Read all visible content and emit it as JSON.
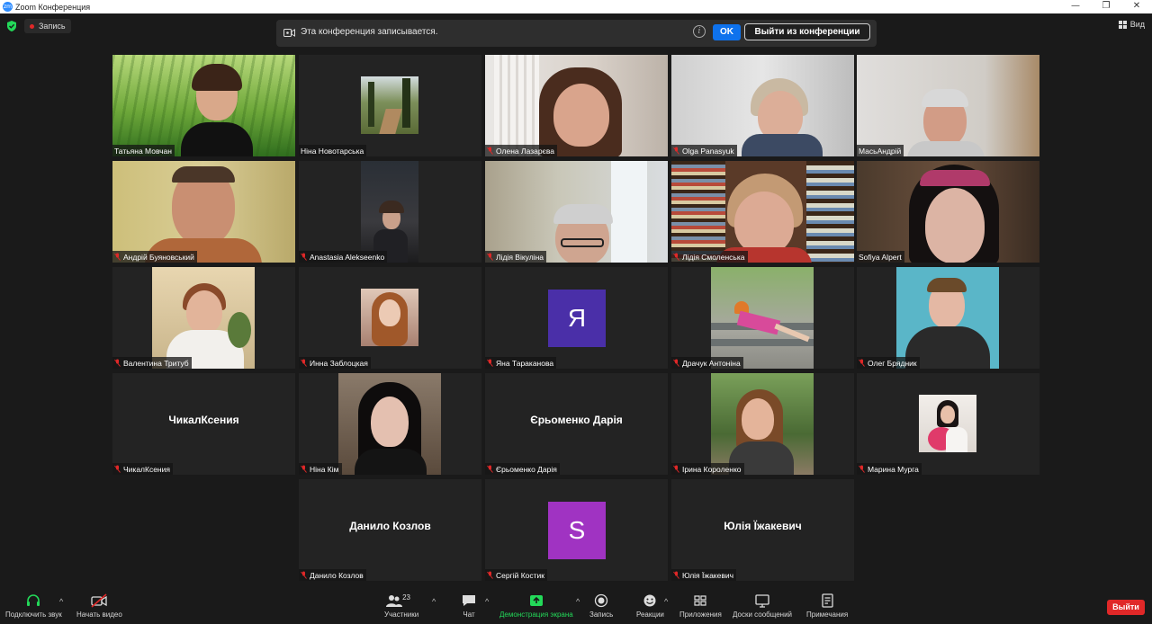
{
  "window": {
    "title": "Zoom Конференция",
    "controls": [
      "—",
      "❐",
      "✕"
    ]
  },
  "topbar": {
    "recording_label": "Запись",
    "view_label": "Вид"
  },
  "banner": {
    "message": "Эта конференция записывается.",
    "ok_label": "OK",
    "leave_label": "Выйти из конференции",
    "info_glyph": "i"
  },
  "colors": {
    "accent": "#0e72ed",
    "danger": "#e02828",
    "active_speaker": "#e8e84a",
    "avatar_ya": "#4a2fa8",
    "avatar_s": "#a033c2"
  },
  "participants": [
    {
      "name": "Татьяна Мовчан",
      "kind": "video",
      "muted": false
    },
    {
      "name": "Ніна Новотарська",
      "kind": "photo",
      "muted": false
    },
    {
      "name": "Олена Лазарєва",
      "kind": "video",
      "muted": true
    },
    {
      "name": "Olga Panasyuk",
      "kind": "video",
      "muted": true
    },
    {
      "name": "МасьАндрій",
      "kind": "video",
      "muted": false
    },
    {
      "name": "Андрій Буяновський",
      "kind": "video",
      "muted": true
    },
    {
      "name": "Anastasia Alekseenko",
      "kind": "video",
      "muted": true
    },
    {
      "name": "Лідія Вікуліна",
      "kind": "video",
      "muted": true
    },
    {
      "name": "Лідія Смоленська",
      "kind": "video",
      "muted": true
    },
    {
      "name": "Sofiya Alpert",
      "kind": "video",
      "muted": false,
      "active": true
    },
    {
      "name": "Валентина Тритуб",
      "kind": "photo",
      "muted": true
    },
    {
      "name": "Инна Заблоцкая",
      "kind": "photo",
      "muted": true
    },
    {
      "name": "Яна Тараканова",
      "kind": "avatar",
      "initial": "Я",
      "muted": true
    },
    {
      "name": "Драчук Антоніна",
      "kind": "photo",
      "muted": true
    },
    {
      "name": "Олег Брядник",
      "kind": "photo",
      "muted": true
    },
    {
      "name": "ЧикалКсения",
      "kind": "name",
      "muted": true
    },
    {
      "name": "Ніна Кім",
      "kind": "photo",
      "muted": true
    },
    {
      "name": "Єрьоменко Дарія",
      "kind": "name",
      "muted": true
    },
    {
      "name": "Ірина Короленко",
      "kind": "photo",
      "muted": true
    },
    {
      "name": "Марина Мурга",
      "kind": "photo",
      "muted": true
    },
    {
      "name": "Данило Козлов",
      "kind": "name",
      "muted": true
    },
    {
      "name": "Сергій Костик",
      "kind": "avatar",
      "initial": "S",
      "muted": true
    },
    {
      "name": "Юлія Їжакевич",
      "kind": "name",
      "muted": true
    }
  ],
  "toolbar": {
    "audio": "Подключить звук",
    "video": "Начать видео",
    "participants": "Участники",
    "participants_count": "23",
    "chat": "Чат",
    "share": "Демонстрация экрана",
    "record": "Запись",
    "reactions": "Реакции",
    "apps": "Приложения",
    "whiteboards": "Доски сообщений",
    "notes": "Примечания",
    "leave": "Выйти"
  }
}
